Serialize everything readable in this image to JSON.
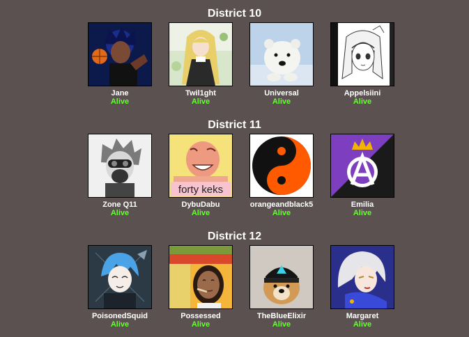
{
  "colors": {
    "background": "#5b5150",
    "alive": "#66ff33",
    "text": "#ffffff"
  },
  "districts": [
    {
      "title": "District 10",
      "tributes": [
        {
          "name": "Jane",
          "status": "Alive",
          "avatar_icon": "anime-basketball-player-icon"
        },
        {
          "name": "Twil1ght",
          "status": "Alive",
          "avatar_icon": "gothic-lolita-girl-icon"
        },
        {
          "name": "Universal",
          "status": "Alive",
          "avatar_icon": "polar-bear-cub-icon"
        },
        {
          "name": "Appelsiini",
          "status": "Alive",
          "avatar_icon": "manga-girl-sketch-icon"
        }
      ]
    },
    {
      "title": "District 11",
      "tributes": [
        {
          "name": "Zone Q11",
          "status": "Alive",
          "avatar_icon": "gas-mask-character-icon"
        },
        {
          "name": "DybuDabu",
          "status": "Alive",
          "avatar_icon": "forty-keks-meme-icon",
          "avatar_caption": "forty keks"
        },
        {
          "name": "orangeandblack5",
          "status": "Alive",
          "avatar_icon": "orange-black-yin-yang-icon"
        },
        {
          "name": "Emilia",
          "status": "Alive",
          "avatar_icon": "anarchy-crown-symbol-icon"
        }
      ]
    },
    {
      "title": "District 12",
      "tributes": [
        {
          "name": "PoisonedSquid",
          "status": "Alive",
          "avatar_icon": "blue-haired-anime-boy-icon"
        },
        {
          "name": "Possessed",
          "status": "Alive",
          "avatar_icon": "woman-with-cigarette-icon"
        },
        {
          "name": "TheBlueElixir",
          "status": "Alive",
          "avatar_icon": "doge-with-beanie-icon"
        },
        {
          "name": "Margaret",
          "status": "Alive",
          "avatar_icon": "white-haired-anime-woman-icon"
        }
      ]
    }
  ]
}
